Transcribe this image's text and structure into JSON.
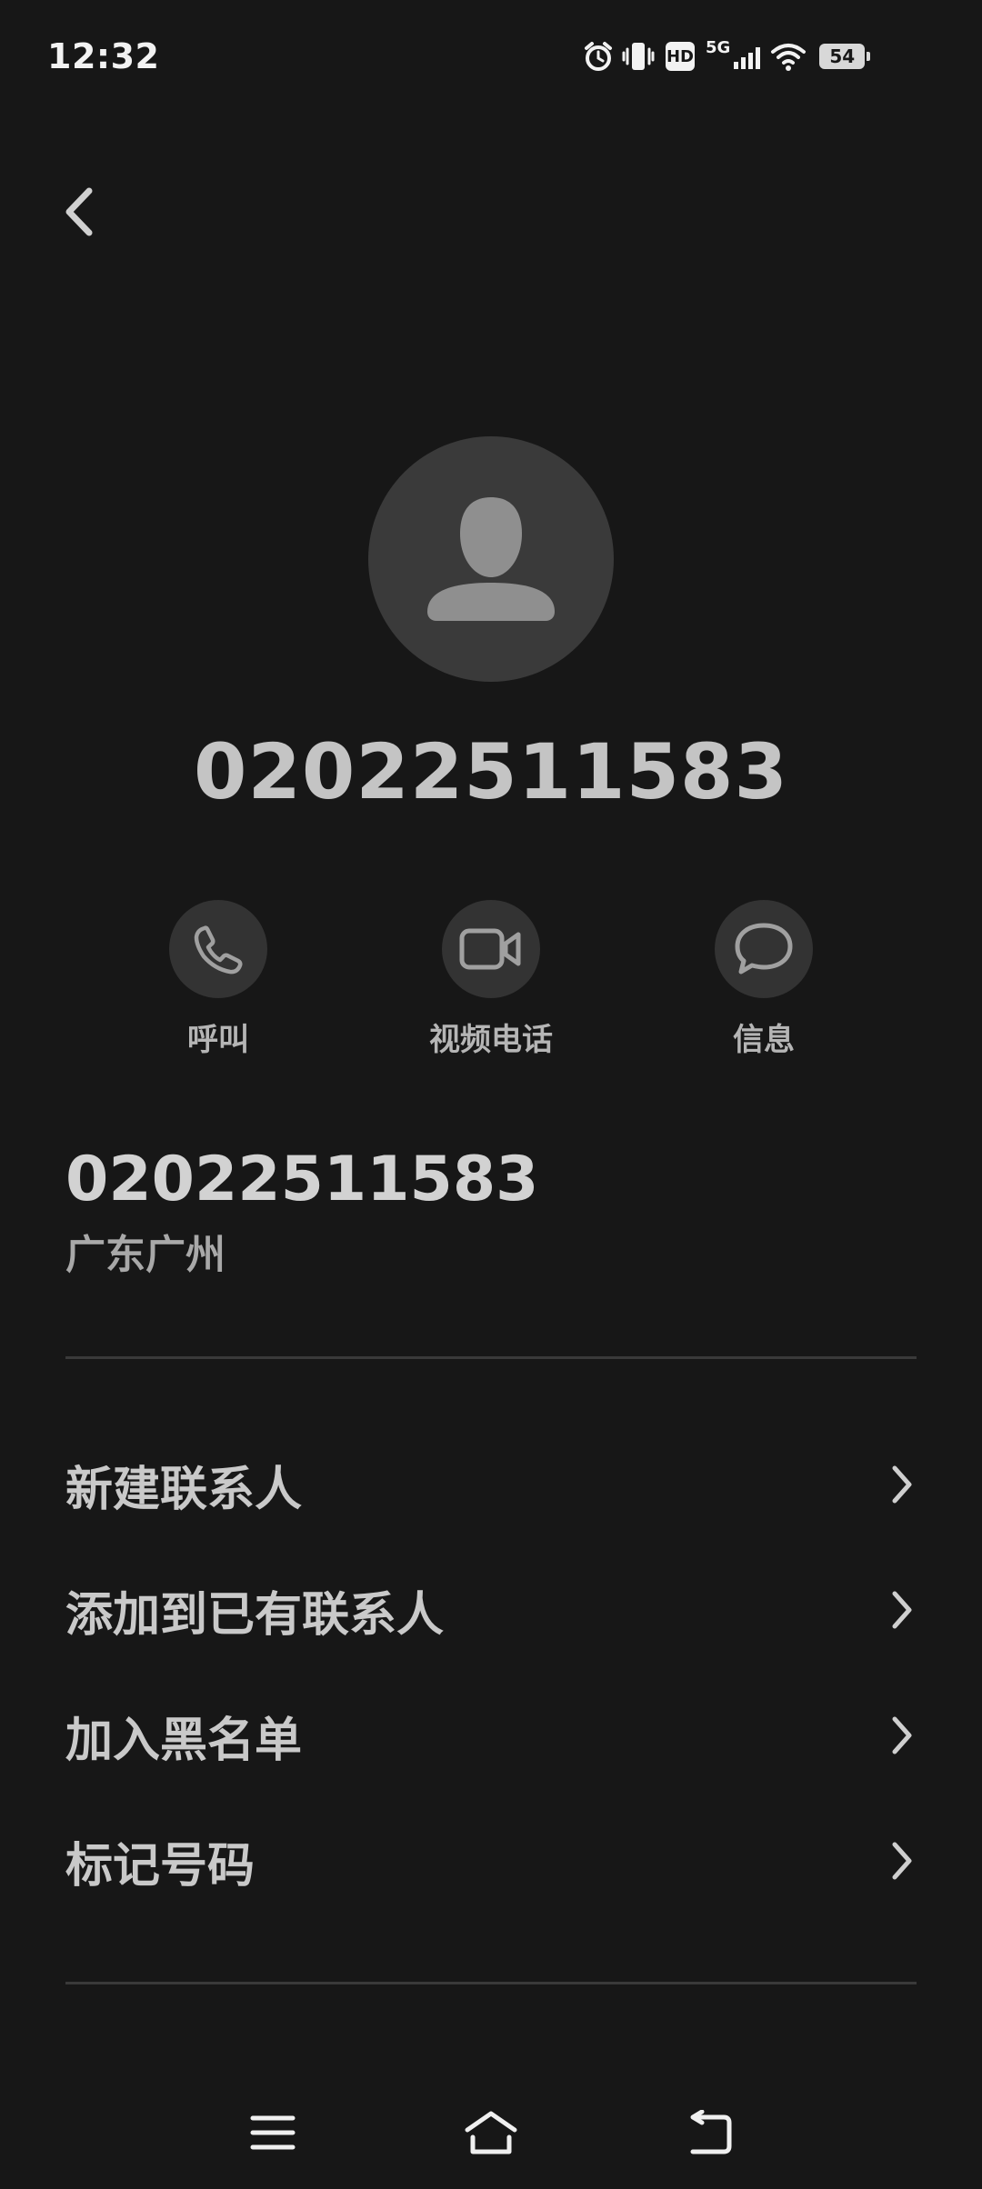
{
  "status_bar": {
    "time": "12:32",
    "network": "5G",
    "hd": "HD",
    "battery": "54",
    "icons": [
      "alarm-icon",
      "vibrate-icon",
      "hd-icon",
      "signal-icon",
      "wifi-icon",
      "battery-icon"
    ]
  },
  "header": {
    "back_icon": "chevron-left-icon"
  },
  "contact": {
    "avatar_icon": "person-icon",
    "number": "02022511583"
  },
  "actions": [
    {
      "label": "呼叫",
      "icon": "phone-icon"
    },
    {
      "label": "视频电话",
      "icon": "video-camera-icon"
    },
    {
      "label": "信息",
      "icon": "message-bubble-icon"
    }
  ],
  "details": {
    "number": "02022511583",
    "location": "广东广州"
  },
  "menu": [
    {
      "label": "新建联系人"
    },
    {
      "label": "添加到已有联系人"
    },
    {
      "label": "加入黑名单"
    },
    {
      "label": "标记号码"
    }
  ],
  "nav_bar": {
    "icons": [
      "menu-icon",
      "home-icon",
      "back-icon"
    ]
  },
  "colors": {
    "background": "#171717",
    "circle": "#333333",
    "avatar_bg": "#3a3a3a",
    "text": "#c9c9c9"
  }
}
